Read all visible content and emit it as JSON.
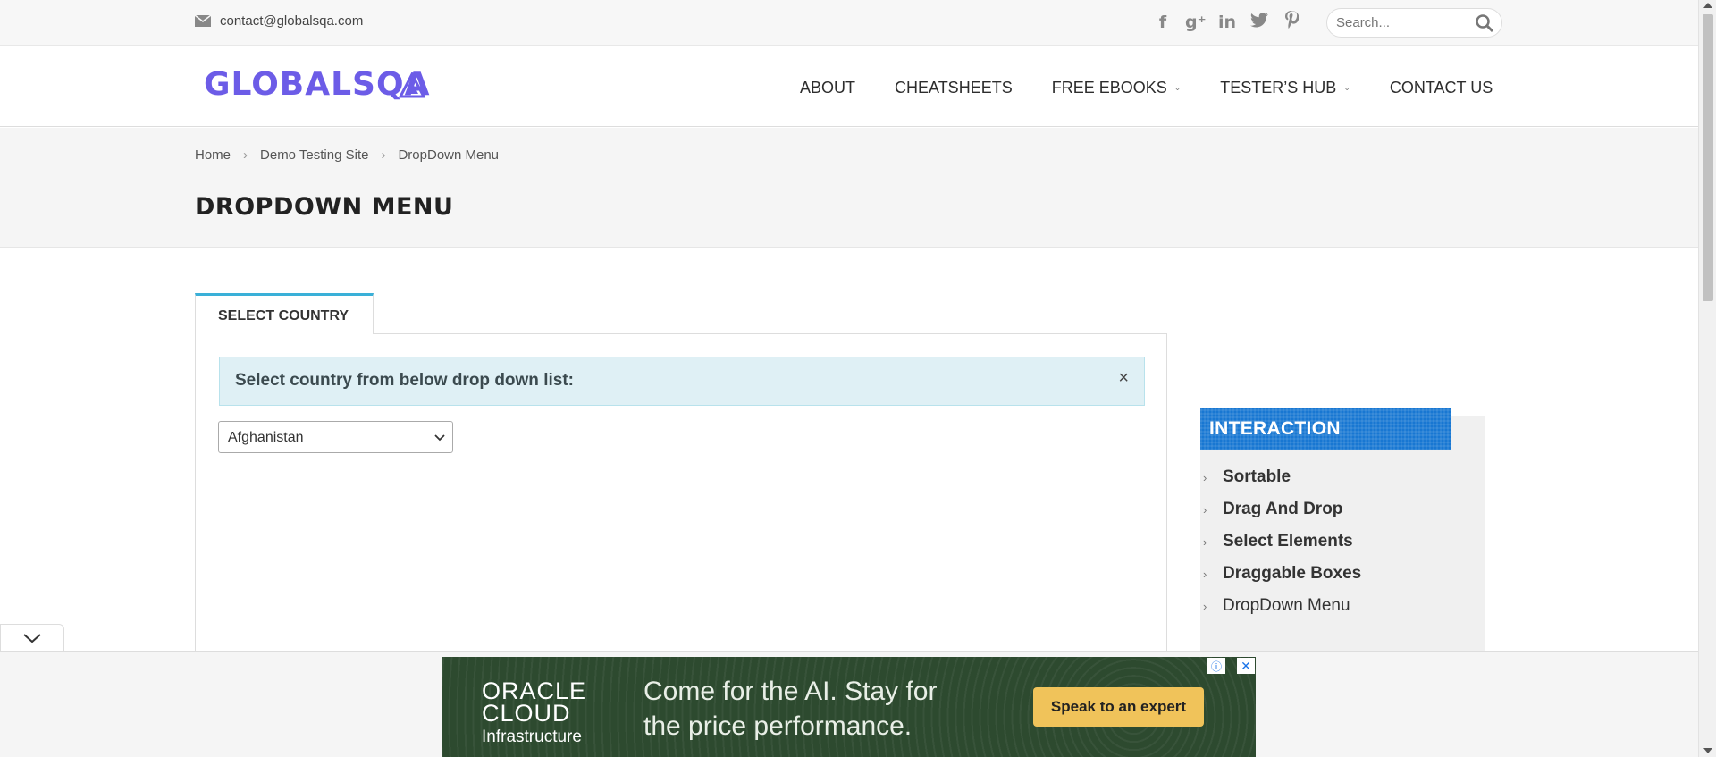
{
  "topbar": {
    "email": "contact@globalsqa.com",
    "social_icons": [
      "facebook-icon",
      "google-plus-icon",
      "linkedin-icon",
      "twitter-icon",
      "pinterest-icon"
    ],
    "search_placeholder": "Search..."
  },
  "header": {
    "logo": "GLOBALSQA",
    "nav": [
      {
        "label": "ABOUT"
      },
      {
        "label": "CHEATSHEETS"
      },
      {
        "label": "FREE EBOOKS",
        "has_dropdown": true
      },
      {
        "label": "TESTER’S HUB",
        "has_dropdown": true
      },
      {
        "label": "CONTACT US"
      }
    ]
  },
  "breadcrumb": [
    "Home",
    "Demo Testing Site",
    "DropDown Menu"
  ],
  "page_title": "DROPDOWN MENU",
  "tab_label": "SELECT COUNTRY",
  "alert_message": "Select country from below drop down list:",
  "alert_close": "×",
  "country_select": {
    "selected": "Afghanistan"
  },
  "sidebar": {
    "title": "INTERACTION",
    "items": [
      {
        "label": "Sortable",
        "bold": true
      },
      {
        "label": "Drag And Drop",
        "bold": true
      },
      {
        "label": "Select Elements",
        "bold": true
      },
      {
        "label": "Draggable Boxes",
        "bold": true
      },
      {
        "label": "DropDown Menu",
        "bold": false
      }
    ]
  },
  "ad": {
    "brand_line1": "ORACLE",
    "brand_line2": "CLOUD",
    "brand_line3": "Infrastructure",
    "headline": "Come for the AI. Stay for the price performance.",
    "cta": "Speak to an expert"
  },
  "colors": {
    "logo": "#6c5ce7",
    "tab_accent": "#3ab0d8",
    "sidebar_header": "#1877d2",
    "alert_bg": "#dff0f5",
    "ad_bg": "#2d4a2f",
    "ad_cta": "#f0c35a"
  }
}
